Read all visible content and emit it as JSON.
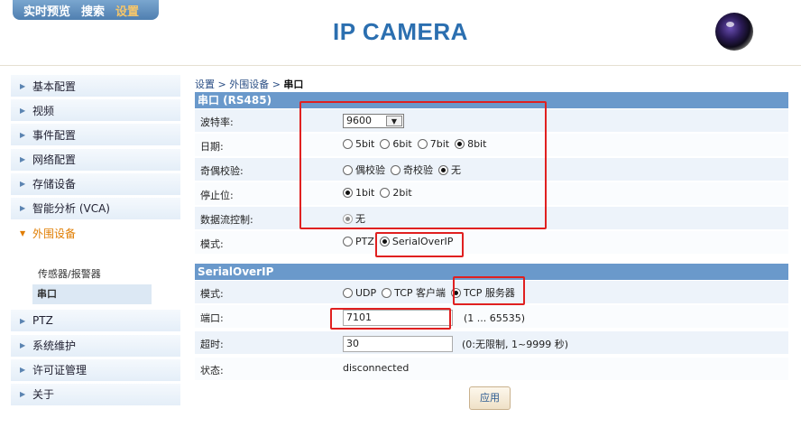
{
  "topnav": {
    "items": [
      "实时预览",
      "搜索",
      "设置"
    ],
    "active": "设置"
  },
  "header": {
    "title": "IP CAMERA"
  },
  "sidebar": {
    "items": [
      {
        "label": "基本配置"
      },
      {
        "label": "视频"
      },
      {
        "label": "事件配置"
      },
      {
        "label": "网络配置"
      },
      {
        "label": "存储设备"
      },
      {
        "label": "智能分析 (VCA)"
      },
      {
        "label": "外围设备"
      },
      {
        "label": "PTZ"
      },
      {
        "label": "系统维护"
      },
      {
        "label": "许可证管理"
      },
      {
        "label": "关于"
      }
    ],
    "sub_items": [
      {
        "label": "传感器/报警器"
      },
      {
        "label": "串口"
      }
    ]
  },
  "breadcrumb": {
    "path": "设置 > 外围设备 > ",
    "current": "串口"
  },
  "serial": {
    "title": "串口 (RS485)",
    "baud_label": "波特率:",
    "baud_value": "9600",
    "data_bits_label": "日期:",
    "data_bits_options": [
      "5bit",
      "6bit",
      "7bit",
      "8bit"
    ],
    "data_bits_selected": "8bit",
    "parity_label": "奇偶校验:",
    "parity_options": [
      "偶校验",
      "奇校验",
      "无"
    ],
    "parity_selected": "无",
    "stop_label": "停止位:",
    "stop_options": [
      "1bit",
      "2bit"
    ],
    "stop_selected": "1bit",
    "flow_label": "数据流控制:",
    "flow_option": "无",
    "mode_label": "模式:",
    "mode_options": [
      "PTZ",
      "SerialOverIP"
    ],
    "mode_selected": "SerialOverIP"
  },
  "soip": {
    "title": "SerialOverIP",
    "mode_label": "模式:",
    "mode_options": [
      "UDP",
      "TCP 客户端",
      "TCP 服务器"
    ],
    "mode_selected": "TCP 服务器",
    "port_label": "端口:",
    "port_value": "7101",
    "port_hint": "(1 ... 65535)",
    "timeout_label": "超时:",
    "timeout_value": "30",
    "timeout_hint": "(0:无限制, 1~9999 秒)",
    "status_label": "状态:",
    "status_value": "disconnected"
  },
  "apply_label": "应用",
  "colors": {
    "accent": "#2b6fb0",
    "section_header": "#6a99cb",
    "highlight": "#e02020",
    "active_menu": "#e07d00"
  }
}
